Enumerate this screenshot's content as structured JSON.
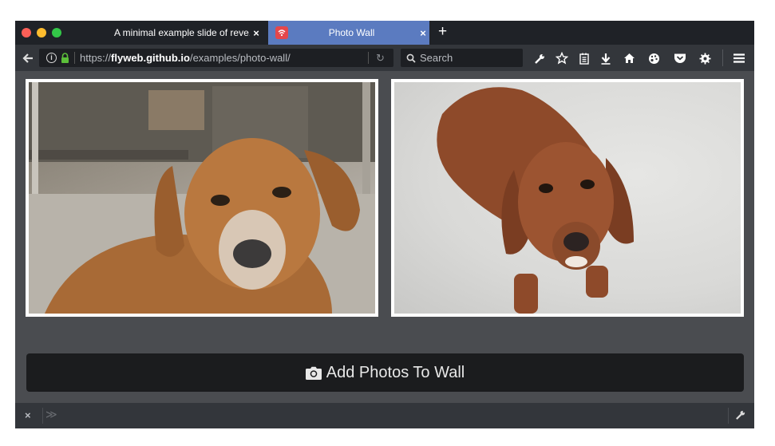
{
  "browser": {
    "tabs": [
      {
        "title": "A minimal example slide of reve...",
        "close": "×",
        "active": false
      },
      {
        "title": "Photo Wall",
        "close": "×",
        "active": true,
        "favicon_color": "#e5474b"
      }
    ],
    "new_tab_label": "+",
    "url": {
      "prefix": "https://",
      "host": "flyweb.github.io",
      "path": "/examples/photo-wall/"
    },
    "search_placeholder": "Search",
    "toolbar_icons": [
      "wrench-icon",
      "star-icon",
      "reading-list-icon",
      "download-icon",
      "home-icon",
      "palette-icon",
      "pocket-icon",
      "settings-icon",
      "menu-icon"
    ],
    "accent_color": "#5b7bc0"
  },
  "page": {
    "photos": [
      {
        "subject": "dog-photo"
      },
      {
        "subject": "dog-photo"
      }
    ],
    "add_button_label": "Add Photos To Wall"
  },
  "devtools_bar": {
    "close": "×",
    "chevron": "≫"
  }
}
